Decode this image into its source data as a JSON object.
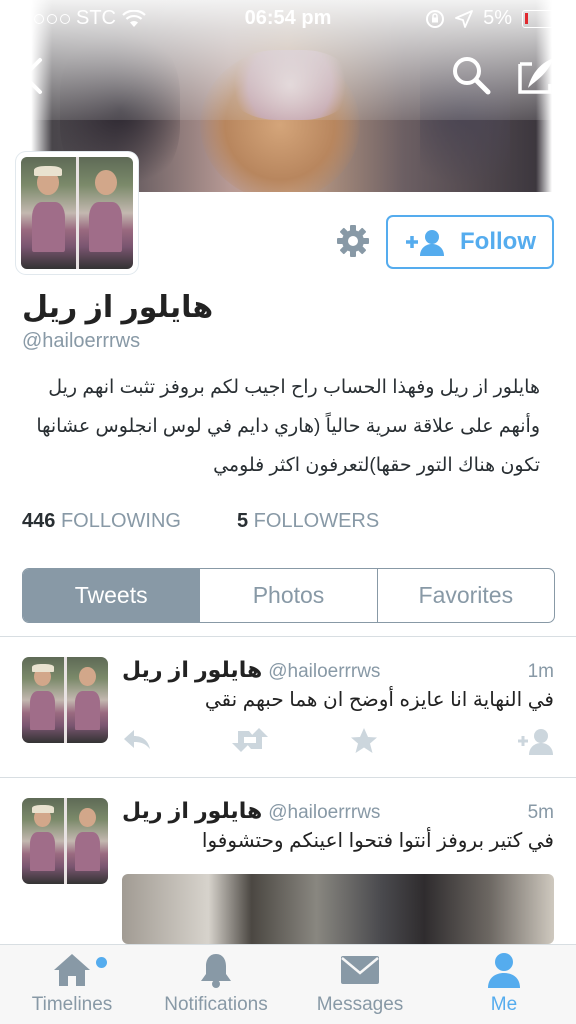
{
  "status_bar": {
    "carrier": "STC",
    "time": "06:54 pm",
    "battery": "5%",
    "signal_bars_filled": 2,
    "signal_bars_total": 5
  },
  "profile": {
    "name": "هايلور از ريل",
    "handle": "@hailoerrrws",
    "bio": "هايلور از ريل وفهذا الحساب راح اجيب لكم بروفز تثبت انهم ريل وأنهم على علاقة سرية حالياً (هاري دايم في لوس انجلوس عشانها تكون هناك التور حقها)لتعرفون اكثر فلومي",
    "follow_label": "Follow",
    "following_count": "446",
    "following_label": "FOLLOWING",
    "followers_count": "5",
    "followers_label": "FOLLOWERS"
  },
  "tabs": [
    {
      "label": "Tweets",
      "active": true
    },
    {
      "label": "Photos",
      "active": false
    },
    {
      "label": "Favorites",
      "active": false
    }
  ],
  "tweets": [
    {
      "name": "هايلور از ريل",
      "handle": "@hailoerrrws",
      "time": "1m",
      "text": "في النهاية انا عايزه أوضح ان هما حبهم نقي"
    },
    {
      "name": "هايلور از ريل",
      "handle": "@hailoerrrws",
      "time": "5m",
      "text": "في كتير بروفز أنتوا فتحوا اعينكم وحتشوفوا"
    }
  ],
  "tab_bar": [
    {
      "label": "Timelines",
      "icon": "home-icon",
      "active": false
    },
    {
      "label": "Notifications",
      "icon": "bell-icon",
      "active": false
    },
    {
      "label": "Messages",
      "icon": "envelope-icon",
      "active": false
    },
    {
      "label": "Me",
      "icon": "person-icon",
      "active": true
    }
  ],
  "colors": {
    "accent": "#55acee",
    "muted": "#8899a6",
    "text": "#292f33",
    "battery_low": "#e0282e"
  }
}
